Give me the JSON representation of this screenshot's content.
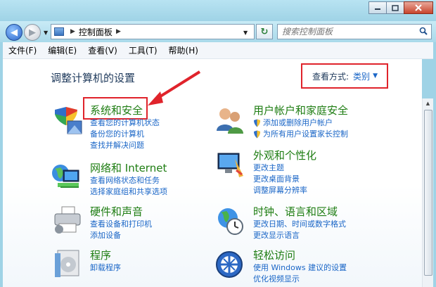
{
  "titlebar": {
    "minimize": "minimize",
    "maximize": "maximize",
    "close": "close"
  },
  "address": {
    "crumbs": [
      "控制面板"
    ],
    "search_placeholder": "搜索控制面板"
  },
  "menu": [
    "文件(F)",
    "编辑(E)",
    "查看(V)",
    "工具(T)",
    "帮助(H)"
  ],
  "page_title": "调整计算机的设置",
  "view": {
    "label": "查看方式:",
    "value": "类别"
  },
  "categories": [
    {
      "title": "系统和安全",
      "icon": "shield-icon",
      "links": [
        "查看您的计算机状态",
        "备份您的计算机",
        "查找并解决问题"
      ]
    },
    {
      "title": "网络和 Internet",
      "icon": "network-icon",
      "links": [
        "查看网络状态和任务",
        "选择家庭组和共享选项"
      ]
    },
    {
      "title": "硬件和声音",
      "icon": "printer-icon",
      "links": [
        "查看设备和打印机",
        "添加设备"
      ]
    },
    {
      "title": "程序",
      "icon": "programs-icon",
      "links": [
        "卸载程序"
      ]
    },
    {
      "title": "用户帐户和家庭安全",
      "icon": "users-icon",
      "links": [
        "添加或删除用户帐户",
        "为所有用户设置家长控制"
      ]
    },
    {
      "title": "外观和个性化",
      "icon": "display-icon",
      "links": [
        "更改主题",
        "更改桌面背景",
        "调整屏幕分辨率"
      ]
    },
    {
      "title": "时钟、语言和区域",
      "icon": "globe-clock-icon",
      "links": [
        "更改日期、时间或数字格式",
        "更改显示语言"
      ]
    },
    {
      "title": "轻松访问",
      "icon": "ease-of-access-icon",
      "links": [
        "使用 Windows 建议的设置",
        "优化视频显示"
      ]
    }
  ],
  "colors": {
    "highlight": "#e0232b",
    "link": "#1a66c7",
    "category": "#1e7d12",
    "title": "#1e395b"
  }
}
